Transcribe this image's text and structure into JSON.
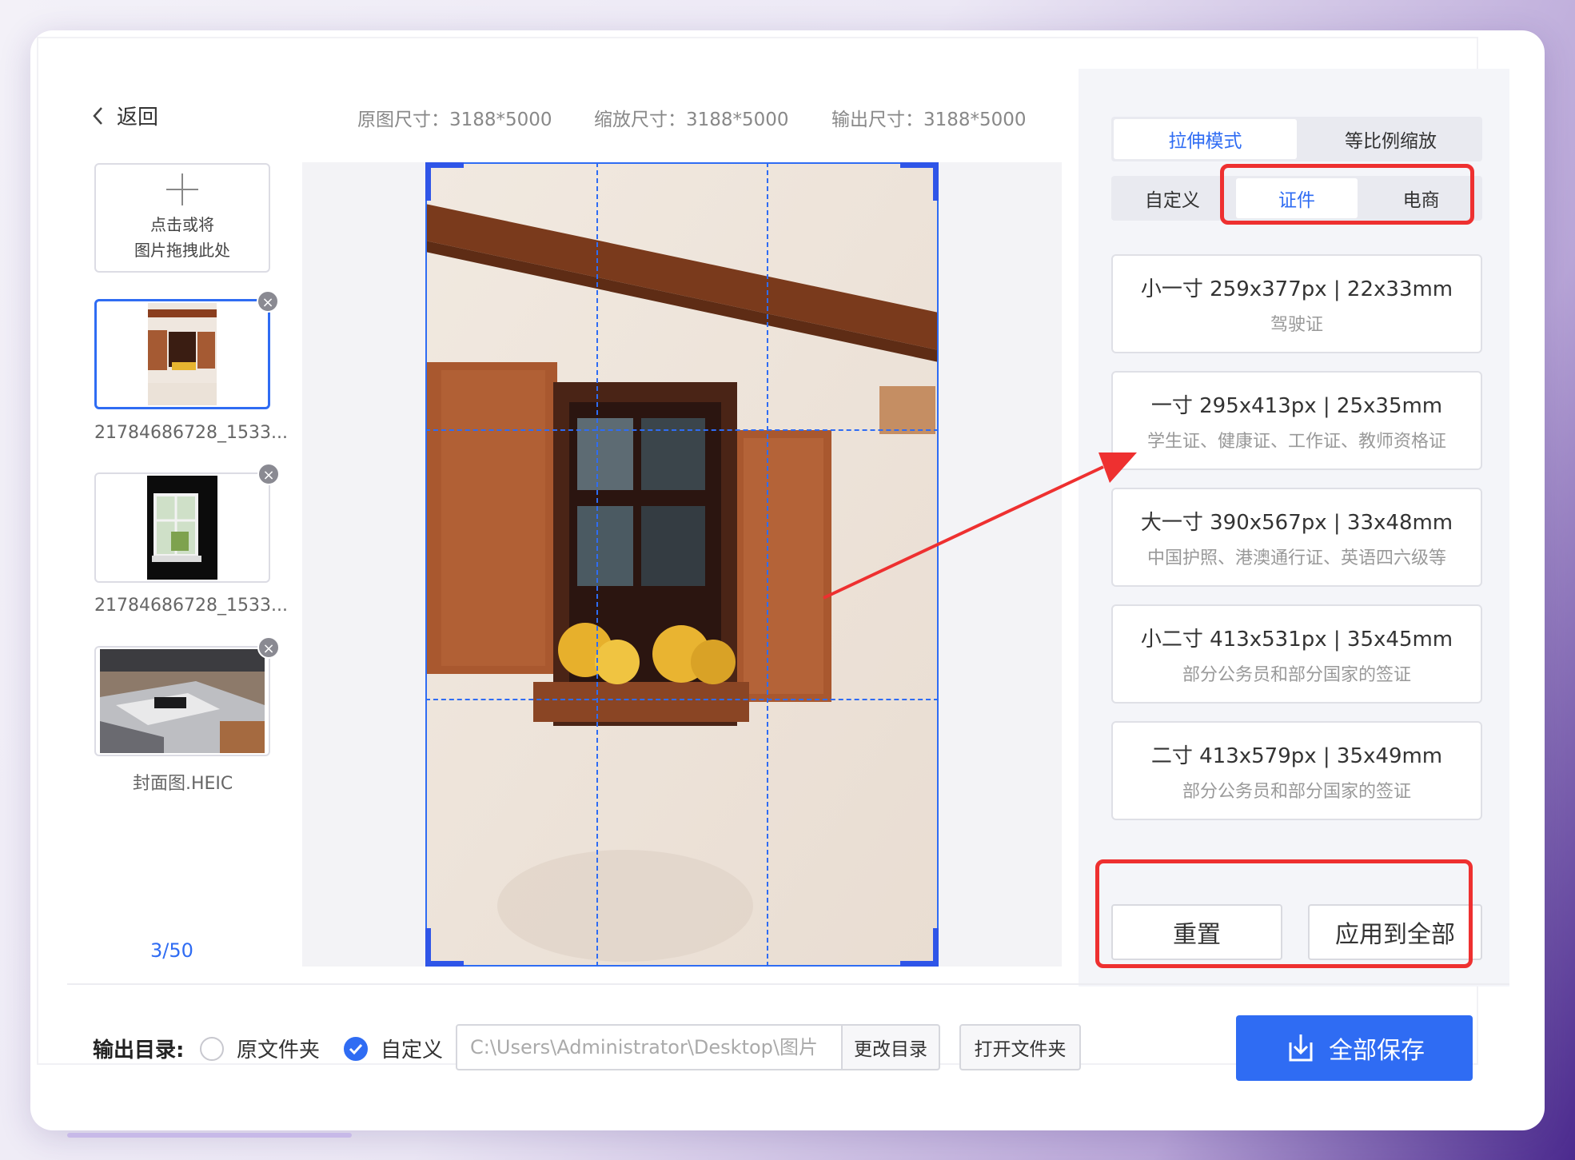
{
  "header": {
    "back_label": "返回",
    "original_size": "原图尺寸：3188*5000",
    "scaled_size": "缩放尺寸：3188*5000",
    "output_size": "输出尺寸：3188*5000"
  },
  "upload": {
    "line1": "点击或将",
    "line2": "图片拖拽此处"
  },
  "files": [
    {
      "name": "21784686728_1533...",
      "selected": true
    },
    {
      "name": "21784686728_1533...",
      "selected": false
    },
    {
      "name": "封面图.HEIC",
      "selected": false
    }
  ],
  "counter": "3/50",
  "mode_tabs": [
    {
      "label": "拉伸模式",
      "active": true
    },
    {
      "label": "等比例缩放",
      "active": false
    }
  ],
  "category_tabs": [
    {
      "label": "自定义",
      "active": false
    },
    {
      "label": "证件",
      "active": true
    },
    {
      "label": "电商",
      "active": false
    }
  ],
  "presets": [
    {
      "title": "小一寸 259x377px | 22x33mm",
      "desc": "驾驶证"
    },
    {
      "title": "一寸 295x413px | 25x35mm",
      "desc": "学生证、健康证、工作证、教师资格证"
    },
    {
      "title": "大一寸 390x567px | 33x48mm",
      "desc": "中国护照、港澳通行证、英语四六级等"
    },
    {
      "title": "小二寸 413x531px | 35x45mm",
      "desc": "部分公务员和部分国家的签证"
    },
    {
      "title": "二寸 413x579px | 35x49mm",
      "desc": "部分公务员和部分国家的签证"
    }
  ],
  "actions": {
    "reset": "重置",
    "apply_all": "应用到全部"
  },
  "output": {
    "label": "输出目录:",
    "option_original": "原文件夹",
    "option_custom": "自定义",
    "selected": "custom",
    "path": "C:\\Users\\Administrator\\Desktop\\图片",
    "change_dir": "更改目录",
    "open_folder": "打开文件夹",
    "save_all": "全部保存"
  },
  "colors": {
    "accent": "#2f6cf3",
    "annotation_red": "#ee3030"
  }
}
